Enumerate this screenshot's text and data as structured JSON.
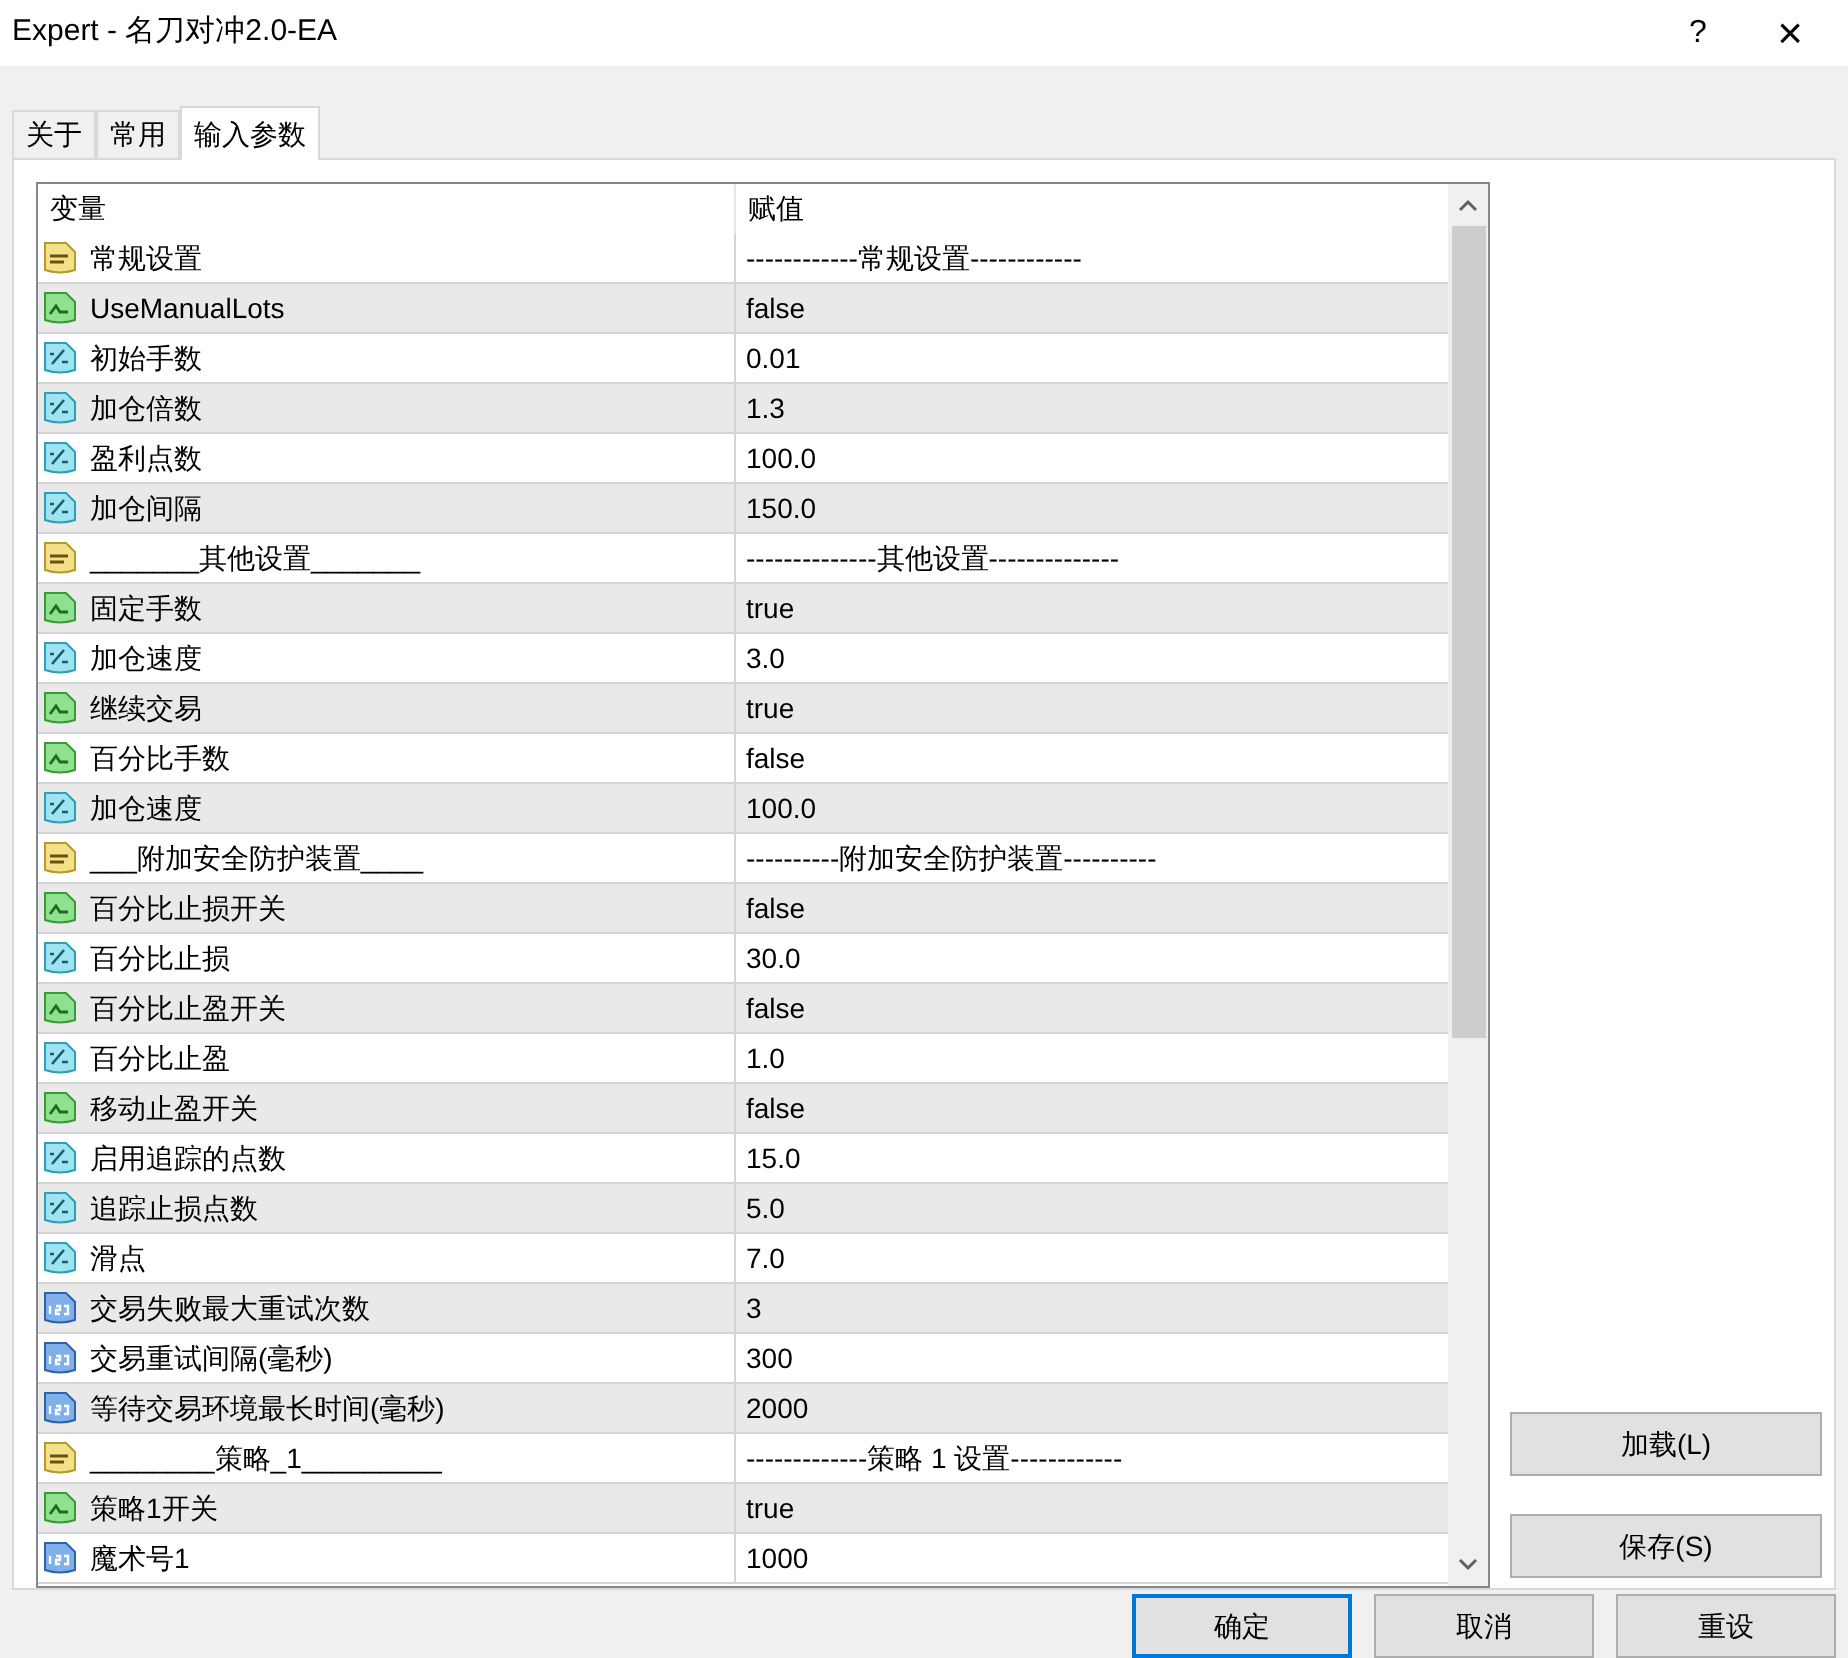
{
  "window": {
    "title": "Expert - 名刀对冲2.0-EA",
    "help": "?",
    "close": "×"
  },
  "tabs": [
    {
      "label": "关于",
      "selected": false
    },
    {
      "label": "常用",
      "selected": false
    },
    {
      "label": "输入参数",
      "selected": true
    }
  ],
  "table": {
    "columns": [
      "变量",
      "赋值"
    ],
    "rows": [
      {
        "kind": "string",
        "name": "常规设置",
        "value": "------------常规设置------------"
      },
      {
        "kind": "bool",
        "name": "UseManualLots",
        "value": "false"
      },
      {
        "kind": "double",
        "name": "初始手数",
        "value": "0.01"
      },
      {
        "kind": "double",
        "name": "加仓倍数",
        "value": "1.3"
      },
      {
        "kind": "double",
        "name": "盈利点数",
        "value": "100.0"
      },
      {
        "kind": "double",
        "name": "加仓间隔",
        "value": "150.0"
      },
      {
        "kind": "string",
        "name": "_______其他设置_______",
        "value": "--------------其他设置--------------"
      },
      {
        "kind": "bool",
        "name": "固定手数",
        "value": "true"
      },
      {
        "kind": "double",
        "name": "加仓速度",
        "value": "3.0"
      },
      {
        "kind": "bool",
        "name": "继续交易",
        "value": "true"
      },
      {
        "kind": "bool",
        "name": "百分比手数",
        "value": "false"
      },
      {
        "kind": "double",
        "name": "加仓速度",
        "value": "100.0"
      },
      {
        "kind": "string",
        "name": "___附加安全防护装置____",
        "value": "----------附加安全防护装置----------"
      },
      {
        "kind": "bool",
        "name": "百分比止损开关",
        "value": "false"
      },
      {
        "kind": "double",
        "name": "百分比止损",
        "value": "30.0"
      },
      {
        "kind": "bool",
        "name": "百分比止盈开关",
        "value": "false"
      },
      {
        "kind": "double",
        "name": "百分比止盈",
        "value": "1.0"
      },
      {
        "kind": "bool",
        "name": "移动止盈开关",
        "value": "false"
      },
      {
        "kind": "double",
        "name": "启用追踪的点数",
        "value": "15.0"
      },
      {
        "kind": "double",
        "name": "追踪止损点数",
        "value": "5.0"
      },
      {
        "kind": "double",
        "name": "滑点",
        "value": "7.0"
      },
      {
        "kind": "int",
        "name": "交易失败最大重试次数",
        "value": "3"
      },
      {
        "kind": "int",
        "name": "交易重试间隔(毫秒)",
        "value": "300"
      },
      {
        "kind": "int",
        "name": "等待交易环境最长时间(毫秒)",
        "value": "2000"
      },
      {
        "kind": "string",
        "name": "________策略_1_________",
        "value": "-------------策略 1 设置------------"
      },
      {
        "kind": "bool",
        "name": "策略1开关",
        "value": "true"
      },
      {
        "kind": "int",
        "name": "魔术号1",
        "value": "1000"
      }
    ]
  },
  "side_buttons": [
    "加载(L)",
    "保存(S)"
  ],
  "buttons": [
    {
      "label": "确定",
      "focused": true
    },
    {
      "label": "取消",
      "focused": false
    },
    {
      "label": "重设",
      "focused": false
    }
  ]
}
